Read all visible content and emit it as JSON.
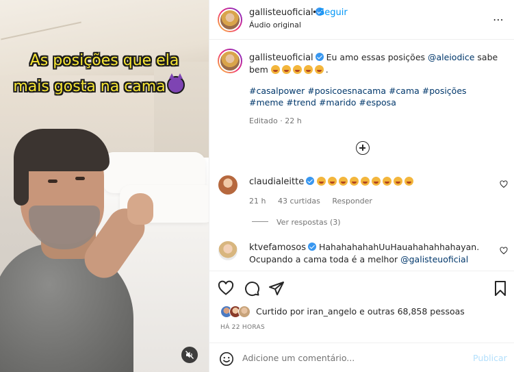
{
  "video": {
    "overlay_line1": "As posições que ela",
    "overlay_line2": "mais gosta na cama",
    "overlay_emoji": "smiling-devil-icon",
    "mute_icon": "speaker-muted-icon"
  },
  "header": {
    "username": "gallisteuoficial",
    "separator": "•",
    "follow_label": "Seguir",
    "audio": "Áudio original",
    "more": "⋯"
  },
  "caption": {
    "username": "gallisteuoficial",
    "text_before": "Eu amo essas posições ",
    "mention": "@aleiodice",
    "text_after": " sabe bem",
    "emoji_count": 5,
    "end": ".",
    "hashtags": "#casalpower #posicoesnacama #cama #posições #meme #trend #marido #esposa",
    "edited": "Editado · 22 h"
  },
  "comments": [
    {
      "username": "claudialeitte",
      "emoji_count": 9,
      "time": "21 h",
      "likes": "43 curtidas",
      "reply": "Responder",
      "view_replies": "Ver respostas (3)"
    },
    {
      "username": "ktvefamosos",
      "text": "HahahahahahUuHauahahahhahayan. Ocupando a cama toda é a melhor ",
      "mention": "@galisteuoficial"
    }
  ],
  "likes": {
    "prefix": "Curtido por ",
    "user": "iran_angelo",
    "middle": " e ",
    "others": "outras 68,858 pessoas"
  },
  "time_ago": "HÁ 22 HORAS",
  "add_comment": {
    "placeholder": "Adicione um comentário...",
    "publish": "Publicar"
  },
  "colors": {
    "accent": "#0095f6",
    "overlay_text": "#f6e534",
    "muted_text": "#737373",
    "hashtag": "#00376b"
  }
}
